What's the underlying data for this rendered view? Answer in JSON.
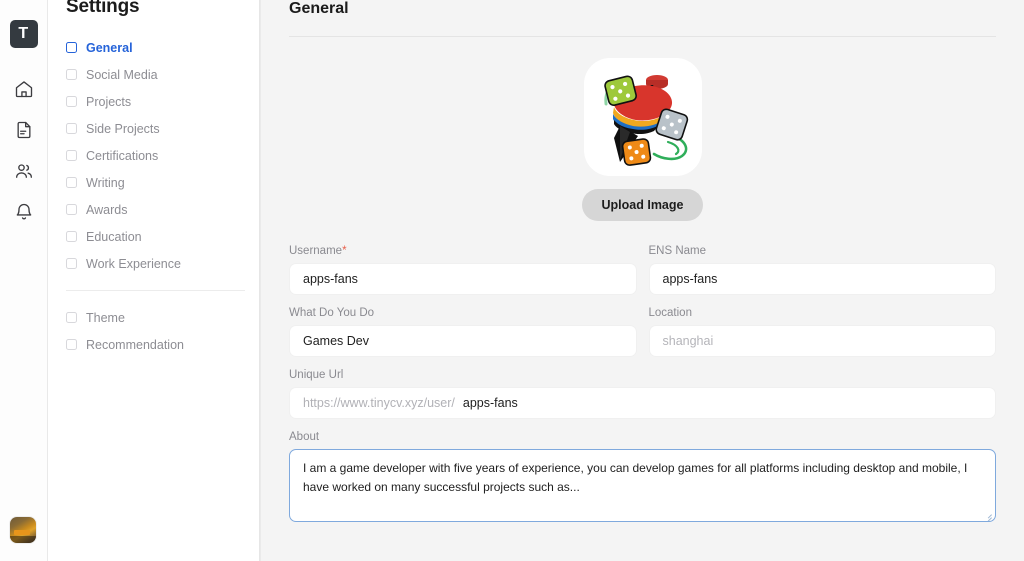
{
  "rail": {
    "logo_text": "T",
    "icons": [
      {
        "name": "home-icon",
        "label": "Home"
      },
      {
        "name": "document-icon",
        "label": "Documents"
      },
      {
        "name": "people-icon",
        "label": "People"
      },
      {
        "name": "bell-icon",
        "label": "Notifications"
      }
    ],
    "avatar_label": "User avatar"
  },
  "settings": {
    "title": "Settings",
    "items": [
      {
        "label": "General",
        "active": true
      },
      {
        "label": "Social Media",
        "active": false
      },
      {
        "label": "Projects",
        "active": false
      },
      {
        "label": "Side Projects",
        "active": false
      },
      {
        "label": "Certifications",
        "active": false
      },
      {
        "label": "Writing",
        "active": false
      },
      {
        "label": "Awards",
        "active": false
      },
      {
        "label": "Education",
        "active": false
      },
      {
        "label": "Work Experience",
        "active": false
      }
    ],
    "secondary_items": [
      {
        "label": "Theme",
        "active": false
      },
      {
        "label": "Recommendation",
        "active": false
      }
    ]
  },
  "main": {
    "title": "General",
    "upload_button_label": "Upload Image",
    "profile_image_alt": "spinning-top-with-dice-logo",
    "fields": {
      "username": {
        "label": "Username",
        "required_marker": "*",
        "value": "apps-fans",
        "placeholder": ""
      },
      "ens_name": {
        "label": "ENS Name",
        "value": "apps-fans",
        "placeholder": ""
      },
      "what_do_you_do": {
        "label": "What Do You Do",
        "value": "Games Dev",
        "placeholder": ""
      },
      "location": {
        "label": "Location",
        "value": "",
        "placeholder": "shanghai"
      },
      "unique_url": {
        "label": "Unique Url",
        "prefix": "https://www.tinycv.xyz/user/",
        "value": "apps-fans"
      },
      "about": {
        "label": "About",
        "value": "I am a game developer with five years of experience, you can develop games for all platforms including desktop and mobile, I have worked on many successful projects such as..."
      }
    }
  },
  "colors": {
    "accent": "#2563d9",
    "required": "#e8604c",
    "focus_border": "#7fa9dd",
    "main_bg": "#f4f4f4",
    "logo_bg": "#343a40"
  }
}
